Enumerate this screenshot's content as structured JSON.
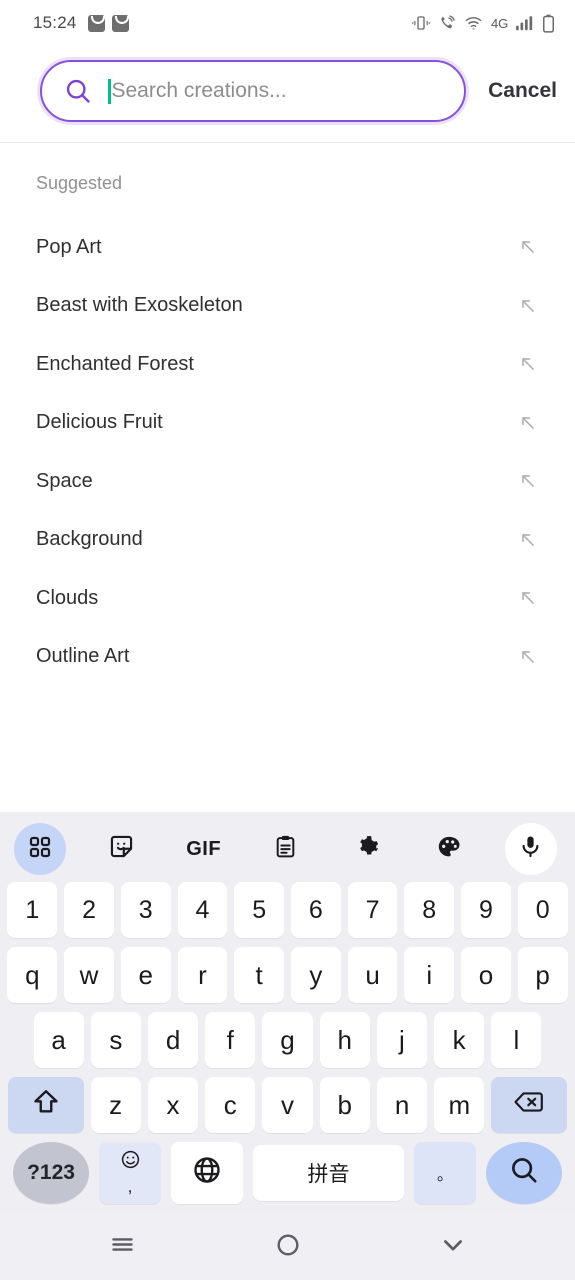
{
  "status_bar": {
    "time": "15:24",
    "app_icons": [
      "shopping-bag-notification",
      "shopping-bag-notification"
    ],
    "network_label": "4G",
    "right_icons": [
      "vibrate-icon",
      "call-icon",
      "wifi-icon",
      "signal-bars-icon",
      "battery-icon"
    ]
  },
  "search": {
    "placeholder": "Search creations...",
    "value": "",
    "cancel_label": "Cancel",
    "border_color": "#8B4FE0",
    "icon_color": "#7B3FD4",
    "caret_color": "#00C08A",
    "search_icon": "search-icon"
  },
  "suggestions": {
    "header": "Suggested",
    "arrow_icon": "arrow-up-left-icon",
    "items": [
      {
        "label": "Pop Art"
      },
      {
        "label": "Beast with Exoskeleton"
      },
      {
        "label": "Enchanted Forest"
      },
      {
        "label": "Delicious Fruit"
      },
      {
        "label": "Space"
      },
      {
        "label": "Background"
      },
      {
        "label": "Clouds"
      },
      {
        "label": "Outline Art"
      }
    ]
  },
  "keyboard": {
    "toolbar": [
      {
        "name": "grid-icon",
        "label": "",
        "active": true
      },
      {
        "name": "sticker-icon",
        "label": ""
      },
      {
        "name": "gif-icon",
        "label": "GIF"
      },
      {
        "name": "clipboard-icon",
        "label": ""
      },
      {
        "name": "gear-icon",
        "label": ""
      },
      {
        "name": "palette-icon",
        "label": ""
      },
      {
        "name": "microphone-icon",
        "label": ""
      }
    ],
    "row_numbers": [
      "1",
      "2",
      "3",
      "4",
      "5",
      "6",
      "7",
      "8",
      "9",
      "0"
    ],
    "row_qwerty": [
      "q",
      "w",
      "e",
      "r",
      "t",
      "y",
      "u",
      "i",
      "o",
      "p"
    ],
    "row_home": [
      "a",
      "s",
      "d",
      "f",
      "g",
      "h",
      "j",
      "k",
      "l"
    ],
    "row_shift": [
      "z",
      "x",
      "c",
      "v",
      "b",
      "n",
      "m"
    ],
    "shift_icon": "shift-icon",
    "backspace_icon": "backspace-icon",
    "num_toggle_label": "?123",
    "emoji_icon": "emoji-icon",
    "comma_label": ",",
    "globe_icon": "globe-icon",
    "space_label": "拼音",
    "period_label": "。",
    "enter_icon": "search-icon",
    "accent_key_color": "#ccd7f2",
    "background": "#eeeef3"
  },
  "navbar": {
    "recents_icon": "menu-icon",
    "home_icon": "circle-icon",
    "hide_keyboard_icon": "chevron-down-icon"
  }
}
